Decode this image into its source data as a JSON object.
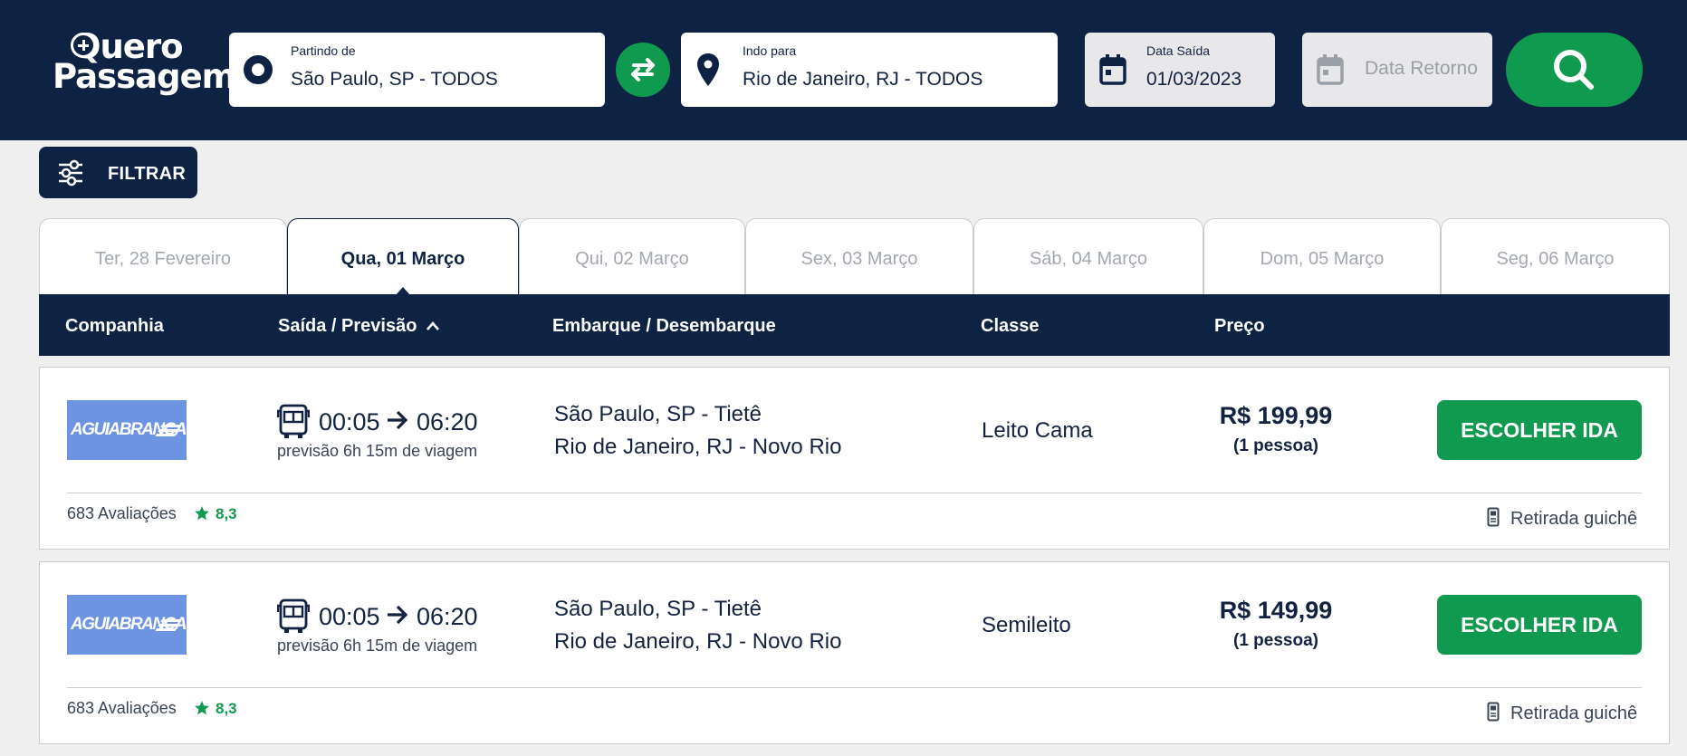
{
  "header": {
    "logo_line1": "Quero",
    "logo_line2": "Passagem",
    "origin": {
      "label": "Partindo de",
      "value": "São Paulo, SP - TODOS"
    },
    "destination": {
      "label": "Indo para",
      "value": "Rio de Janeiro, RJ - TODOS"
    },
    "departure_date": {
      "label": "Data Saída",
      "value": "01/03/2023"
    },
    "return_date": {
      "placeholder": "Data Retorno"
    }
  },
  "filter": {
    "label": "FILTRAR"
  },
  "date_tabs": [
    {
      "label": "Ter, 28 Fevereiro",
      "active": false
    },
    {
      "label": "Qua, 01 Março",
      "active": true
    },
    {
      "label": "Qui, 02 Março",
      "active": false
    },
    {
      "label": "Sex, 03 Março",
      "active": false
    },
    {
      "label": "Sáb, 04 Março",
      "active": false
    },
    {
      "label": "Dom, 05 Março",
      "active": false
    },
    {
      "label": "Seg, 06 Março",
      "active": false
    }
  ],
  "columns": {
    "company": "Companhia",
    "departure": "Saída / Previsão",
    "boarding": "Embarque / Desembarque",
    "class": "Classe",
    "price": "Preço"
  },
  "trips": [
    {
      "company_logo_text": "AGUIABRANCA",
      "departure": "00:05",
      "arrival": "06:20",
      "duration": "previsão 6h 15m de viagem",
      "origin_station": "São Paulo, SP - Tietê",
      "destination_station": "Rio de Janeiro, RJ - Novo Rio",
      "class": "Leito Cama",
      "price": "R$ 199,99",
      "persons": "(1 pessoa)",
      "button": "ESCOLHER IDA",
      "reviews": "683 Avaliações",
      "rating": "8,3",
      "pickup": "Retirada guichê"
    },
    {
      "company_logo_text": "AGUIABRANCA",
      "departure": "00:05",
      "arrival": "06:20",
      "duration": "previsão 6h 15m de viagem",
      "origin_station": "São Paulo, SP - Tietê",
      "destination_station": "Rio de Janeiro, RJ - Novo Rio",
      "class": "Semileito",
      "price": "R$ 149,99",
      "persons": "(1 pessoa)",
      "button": "ESCOLHER IDA",
      "reviews": "683 Avaliações",
      "rating": "8,3",
      "pickup": "Retirada guichê"
    }
  ],
  "colors": {
    "navy": "#0e2244",
    "green": "#0f9a4f",
    "brand_logo_blue": "#6d94e0"
  }
}
